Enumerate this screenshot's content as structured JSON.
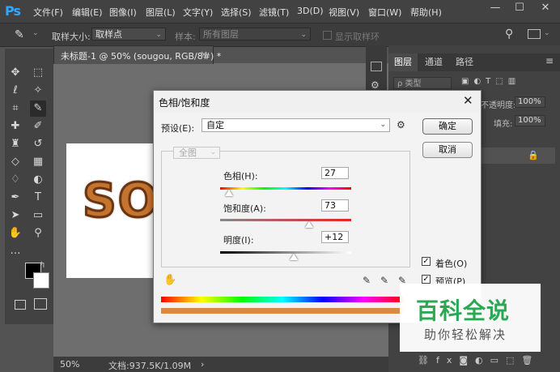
{
  "menubar": {
    "logo": "Ps",
    "items": [
      "文件(F)",
      "编辑(E)",
      "图像(I)",
      "图层(L)",
      "文字(Y)",
      "选择(S)",
      "滤镜(T)",
      "3D(D)",
      "视图(V)",
      "窗口(W)",
      "帮助(H)"
    ]
  },
  "options": {
    "sample_size_label": "取样大小:",
    "sample_size_value": "取样点",
    "sample_label": "样本:",
    "sample_value": "所有图层",
    "show_ring_label": "显示取样环"
  },
  "document": {
    "tab_title": "未标题-1 @ 50% (sougou, RGB/8#) *",
    "canvas_text": "SO",
    "zoom": "50%",
    "doc_info": "文档:937.5K/1.09M"
  },
  "panel": {
    "tabs": [
      "图层",
      "通道",
      "路径"
    ],
    "kind_label": "ρ 类型",
    "opacity_label": "不透明度:",
    "opacity_value": "100%",
    "fill_label": "填充:",
    "fill_value": "100%"
  },
  "dialog": {
    "title": "色相/饱和度",
    "preset_label": "预设(E):",
    "preset_value": "自定",
    "ok_label": "确定",
    "cancel_label": "取消",
    "channel_value": "全图",
    "hue_label": "色相(H):",
    "hue_value": "27",
    "saturation_label": "饱和度(A):",
    "saturation_value": "73",
    "lightness_label": "明度(I):",
    "lightness_value": "+12",
    "colorize_label": "着色(O)",
    "colorize_checked": true,
    "preview_label": "预览(P)",
    "preview_checked": true,
    "hue_level": 0.07,
    "saturation_level": 0.68,
    "lightness_level": 0.56
  },
  "watermark": {
    "title": "百科全说",
    "subtitle": "助你轻松解决"
  },
  "colors": {
    "accent_blue": "#31a8ff",
    "watermark_green": "#2aa853",
    "canvas_text_fill": "#c4742f"
  }
}
